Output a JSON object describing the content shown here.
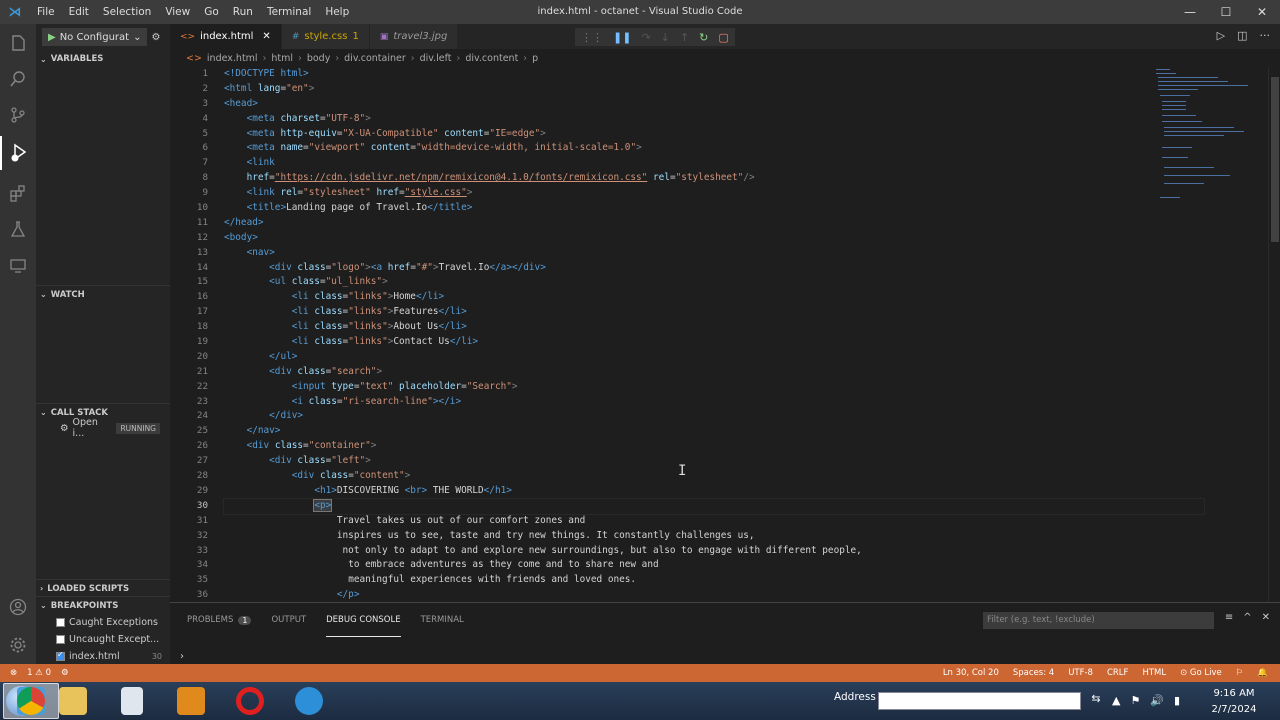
{
  "titlebar": {
    "menu": [
      "File",
      "Edit",
      "Selection",
      "View",
      "Go",
      "Run",
      "Terminal",
      "Help"
    ],
    "title": "index.html - octanet - Visual Studio Code"
  },
  "sidebar": {
    "config": "No Configurat",
    "variables": "VARIABLES",
    "watch": "WATCH",
    "call_stack": "CALL STACK",
    "call_item": "Open i...",
    "call_status": "RUNNING",
    "loaded": "LOADED SCRIPTS",
    "breakpoints": "BREAKPOINTS",
    "bp": [
      {
        "label": "Caught Exceptions",
        "checked": false
      },
      {
        "label": "Uncaught Except...",
        "checked": false
      },
      {
        "label": "index.html",
        "checked": true,
        "line": "30"
      }
    ]
  },
  "tabs": [
    {
      "label": "index.html",
      "active": true
    },
    {
      "label": "style.css",
      "badge": "1"
    },
    {
      "label": "travel3.jpg"
    }
  ],
  "breadcrumb": [
    "index.html",
    "html",
    "body",
    "div.container",
    "div.left",
    "div.content",
    "p"
  ],
  "lines": [
    "1",
    "2",
    "3",
    "4",
    "5",
    "6",
    "7",
    "8",
    "9",
    "10",
    "11",
    "12",
    "13",
    "14",
    "15",
    "16",
    "17",
    "18",
    "19",
    "20",
    "21",
    "22",
    "23",
    "24",
    "25",
    "26",
    "27",
    "28",
    "29",
    "30",
    "31",
    "32",
    "33",
    "34",
    "35",
    "36"
  ],
  "code": {
    "l1": "<!DOCTYPE html>",
    "l2a": "<html ",
    "l2b": "lang",
    "l2c": "=",
    "l2d": "\"en\"",
    "l2e": ">",
    "l3": "<head>",
    "l4a": "<meta ",
    "l4b": "charset",
    "l4c": "\"UTF-8\"",
    "l5a": "<meta ",
    "l5b": "http-equiv",
    "l5c": "\"X-UA-Compatible\"",
    "l5d": "content",
    "l5e": "\"IE=edge\"",
    "l6a": "<meta ",
    "l6b": "name",
    "l6c": "\"viewport\"",
    "l6d": "content",
    "l6e": "\"width=device-width, initial-scale=1.0\"",
    "l7": "<link",
    "l8a": "href",
    "l8b": "\"https://cdn.jsdelivr.net/npm/remixicon@4.1.0/fonts/remixicon.css\"",
    "l8c": "rel",
    "l8d": "\"stylesheet\"",
    "l8e": "/>",
    "l9a": "<link ",
    "l9b": "rel",
    "l9c": "\"stylesheet\"",
    "l9d": "href",
    "l9e": "\"style.css\"",
    "l10a": "<title>",
    "l10b": "Landing page of Travel.Io",
    "l10c": "</title>",
    "l11": "</head>",
    "l12": "<body>",
    "l13": "<nav>",
    "l14a": "<div ",
    "l14b": "class",
    "l14c": "\"logo\"",
    "l14d": "<a ",
    "l14e": "href",
    "l14f": "\"#\"",
    "l14g": "Travel.Io",
    "l14h": "</a></div>",
    "l15a": "<ul ",
    "l15b": "class",
    "l15c": "\"ul_links\"",
    "li_class": "class",
    "li_val": "\"links\"",
    "l16": "Home",
    "l17": "Features",
    "l18": "About Us",
    "l19": "Contact Us",
    "l20": "</ul>",
    "l21a": "<div ",
    "l21b": "class",
    "l21c": "\"search\"",
    "l22a": "<input ",
    "l22b": "type",
    "l22c": "\"text\"",
    "l22d": "placeholder",
    "l22e": "\"Search\"",
    "l23a": "<i ",
    "l23b": "class",
    "l23c": "\"ri-search-line\"",
    "l23d": "></i>",
    "l24": "</div>",
    "l25": "</nav>",
    "l26a": "<div ",
    "l26b": "class",
    "l26c": "\"container\"",
    "l27a": "<div ",
    "l27b": "class",
    "l27c": "\"left\"",
    "l28a": "<div ",
    "l28b": "class",
    "l28c": "\"content\"",
    "l29a": "<h1>",
    "l29b": "DISCOVERING ",
    "l29c": "<br>",
    "l29d": " THE WORLD",
    "l29e": "</h1>",
    "l30": "<p>",
    "l31": "Travel takes us out of our comfort zones and",
    "l32": "inspires us to see, taste and try new things. It constantly challenges us,",
    "l33": "not only to adapt to and explore new surroundings, but also to engage with different people,",
    "l34": "to embrace adventures as they come and to share new and",
    "l35": "meaningful experiences with friends and loved ones.",
    "l36": "</p>"
  },
  "panel": {
    "tabs": [
      "PROBLEMS",
      "OUTPUT",
      "DEBUG CONSOLE",
      "TERMINAL"
    ],
    "problems_badge": "1",
    "filter_placeholder": "Filter (e.g. text, !exclude)"
  },
  "status": {
    "errors": "1",
    "warnings": "0",
    "position": "Ln 30, Col 20",
    "spaces": "Spaces: 4",
    "encoding": "UTF-8",
    "eol": "CRLF",
    "language": "HTML",
    "golive": "Go Live"
  },
  "taskbar": {
    "address_label": "Address",
    "time": "9:16 AM",
    "date": "2/7/2024"
  },
  "colors": {
    "status_bar": "#cc6633",
    "accent": "#007acc"
  }
}
